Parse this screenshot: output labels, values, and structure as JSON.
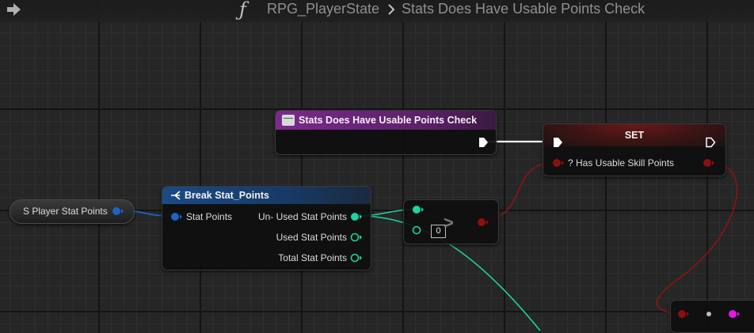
{
  "breadcrumb": {
    "function_icon": "ƒ",
    "owner": "RPG_PlayerState",
    "function_name": "Stats Does Have Usable Points Check"
  },
  "colors": {
    "exec": "#ffffff",
    "struct_pin": "#1e63c8",
    "int_pin": "#1ed3a0",
    "bool_pin": "#8c0f0f",
    "magenta_pin": "#e21ae2",
    "entry_header": "#7b2a8c",
    "break_header": "#1b4a86",
    "set_header": "#6a1818"
  },
  "nodes": {
    "entry": {
      "title": "Stats Does Have Usable Points Check",
      "icon": "function-entry-icon"
    },
    "set": {
      "title": "SET",
      "var_label": "? Has Usable Skill Points"
    },
    "getter": {
      "label": "S Player Stat Points"
    },
    "break": {
      "title": "Break Stat_Points",
      "input_label": "Stat Points",
      "outputs": [
        "Un- Used Stat Points",
        "Used Stat Points",
        "Total Stat Points"
      ]
    },
    "compare": {
      "operator": ">",
      "default_value": "0"
    }
  }
}
